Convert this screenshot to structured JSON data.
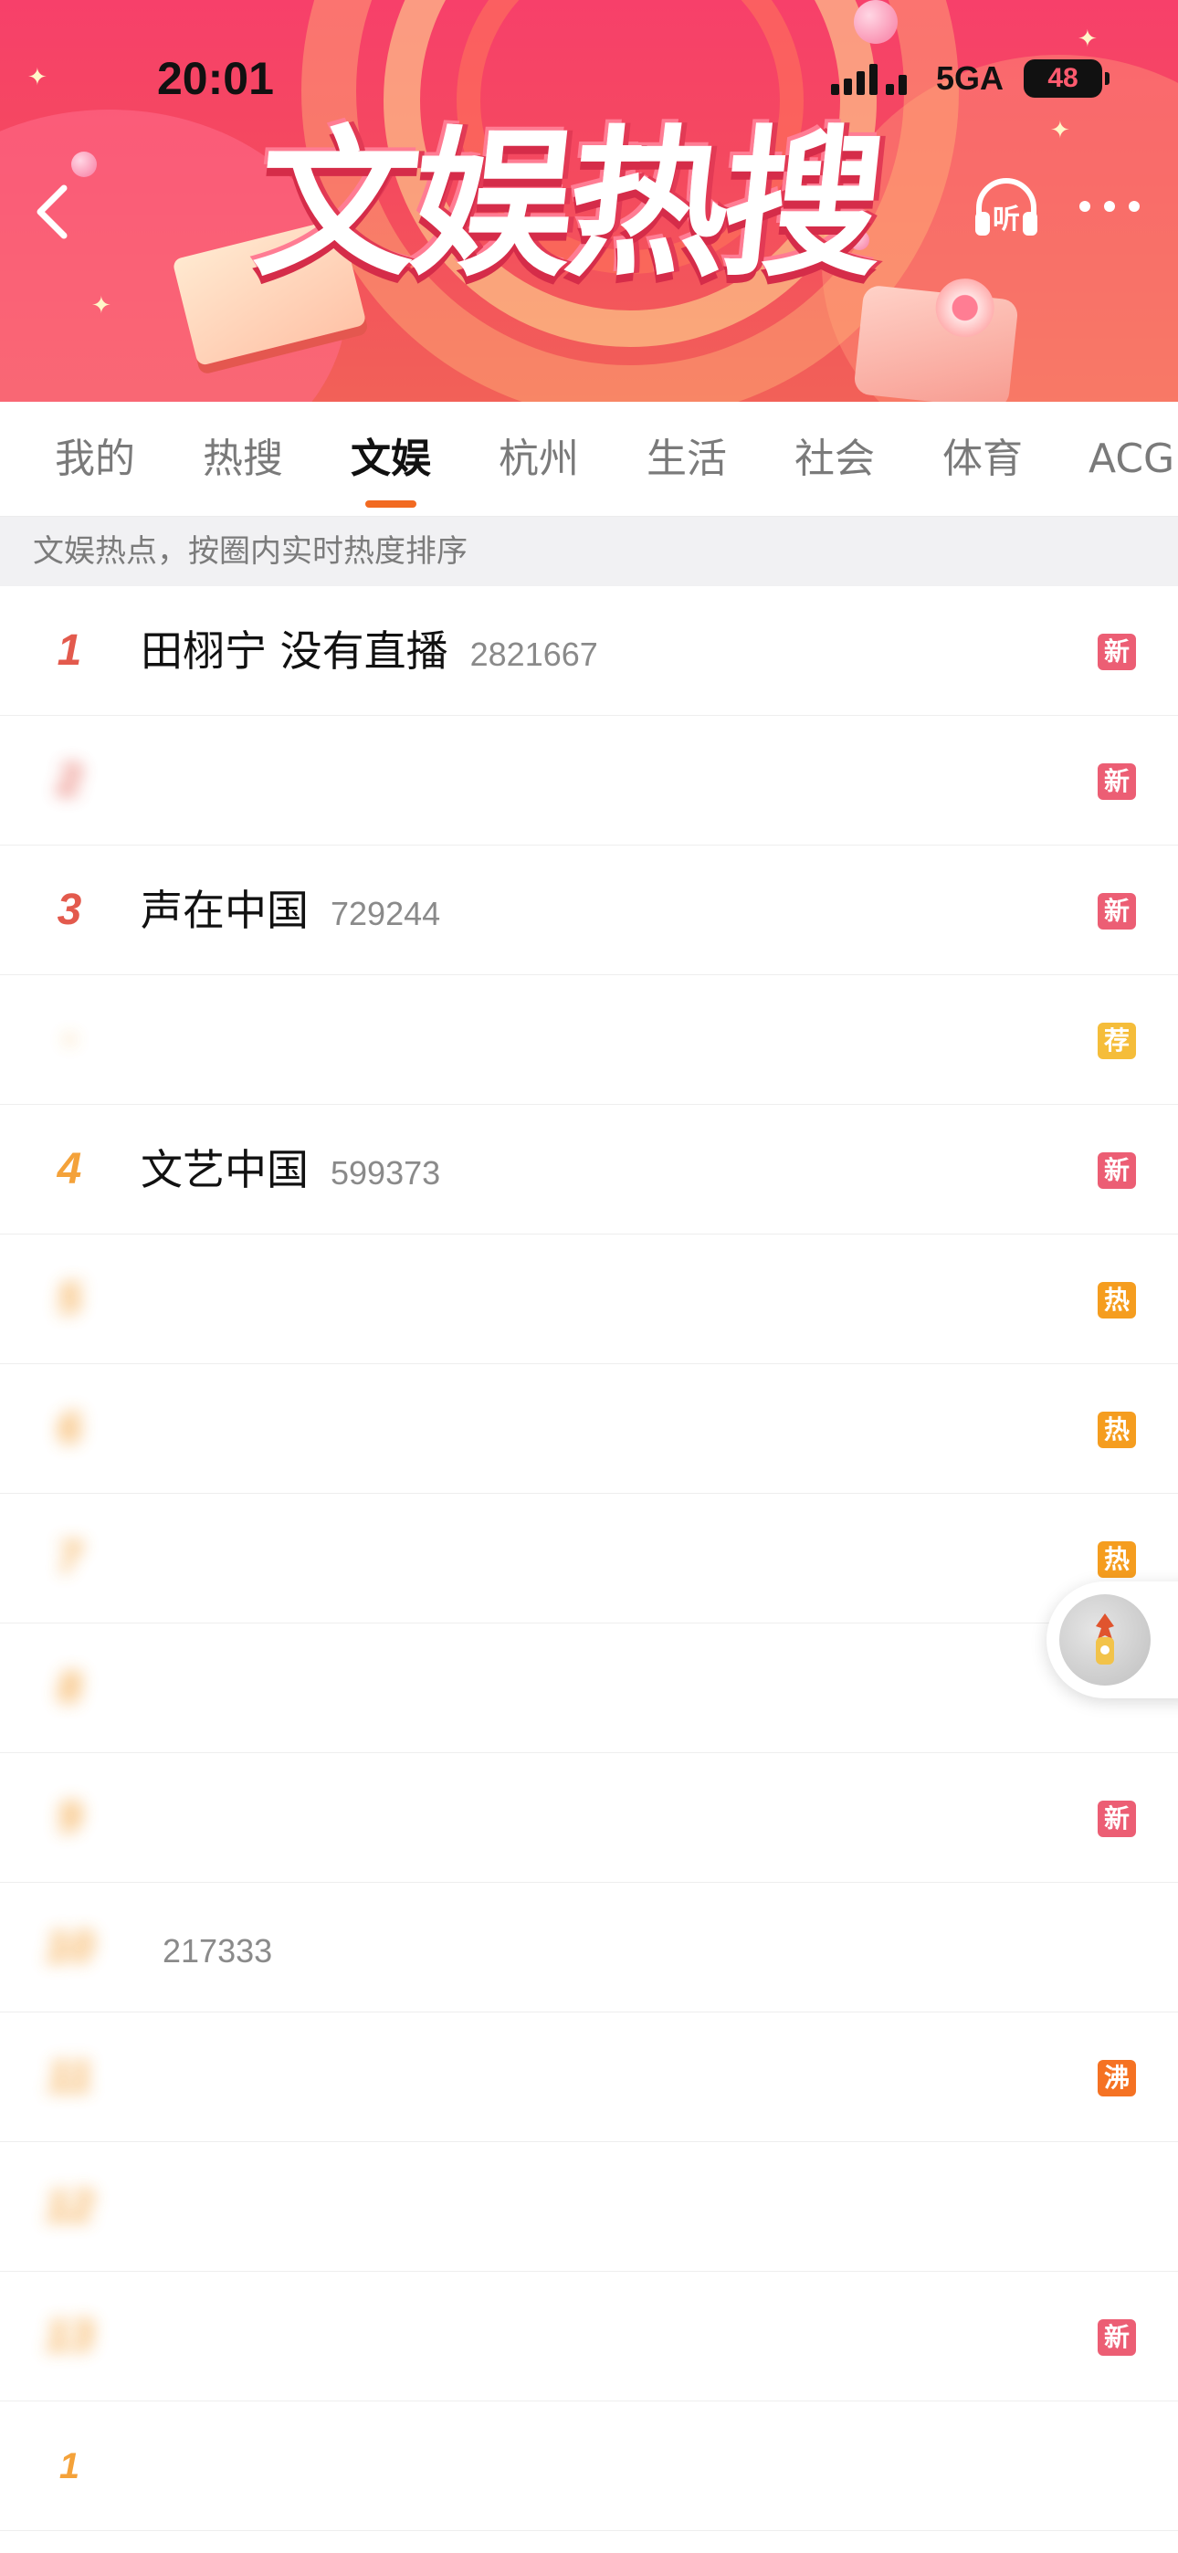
{
  "status_bar": {
    "time": "20:01",
    "network": "5GA",
    "battery": "48"
  },
  "header": {
    "title": "文娱热搜"
  },
  "tabs": [
    {
      "label": "我的"
    },
    {
      "label": "热搜"
    },
    {
      "label": "文娱"
    },
    {
      "label": "杭州"
    },
    {
      "label": "生活"
    },
    {
      "label": "社会"
    },
    {
      "label": "体育"
    },
    {
      "label": "ACG"
    }
  ],
  "active_tab": "文娱",
  "subheader": "文娱热点，按圈内实时热度排序",
  "list": [
    {
      "rank": "1",
      "title": "田栩宁 没有直播",
      "heat": "2821667",
      "badge": "新",
      "blurred": false
    },
    {
      "rank": "2",
      "title": "",
      "heat": "",
      "badge": "新",
      "blurred": true
    },
    {
      "rank": "3",
      "title": "声在中国",
      "heat": "729244",
      "badge": "新",
      "blurred": false
    },
    {
      "rank": "•",
      "title": "",
      "heat": "",
      "badge": "荐",
      "blurred": true
    },
    {
      "rank": "4",
      "title": "文艺中国",
      "heat": "599373",
      "badge": "新",
      "blurred": false
    },
    {
      "rank": "5",
      "title": "",
      "heat": "",
      "badge": "热",
      "blurred": true
    },
    {
      "rank": "6",
      "title": "",
      "heat": "",
      "badge": "热",
      "blurred": true
    },
    {
      "rank": "7",
      "title": "",
      "heat": "",
      "badge": "热",
      "blurred": true
    },
    {
      "rank": "8",
      "title": "",
      "heat": "",
      "badge": "",
      "blurred": true
    },
    {
      "rank": "9",
      "title": "",
      "heat": "",
      "badge": "新",
      "blurred": true
    },
    {
      "rank": "10",
      "title": "",
      "heat": "217333",
      "badge": "",
      "blurred": true
    },
    {
      "rank": "11",
      "title": "",
      "heat": "",
      "badge": "沸",
      "blurred": true
    },
    {
      "rank": "12",
      "title": "",
      "heat": "",
      "badge": "",
      "blurred": true
    },
    {
      "rank": "13",
      "title": "",
      "heat": "",
      "badge": "新",
      "blurred": true
    },
    {
      "rank": "1",
      "title": "",
      "heat": "",
      "badge": "",
      "blurred": true
    }
  ],
  "colors": {
    "accent": "#f26a21",
    "badge_new": "#ec5e74",
    "badge_hot": "#f59d1f",
    "badge_rec": "#f5bd3a",
    "badge_boil": "#f57223"
  }
}
